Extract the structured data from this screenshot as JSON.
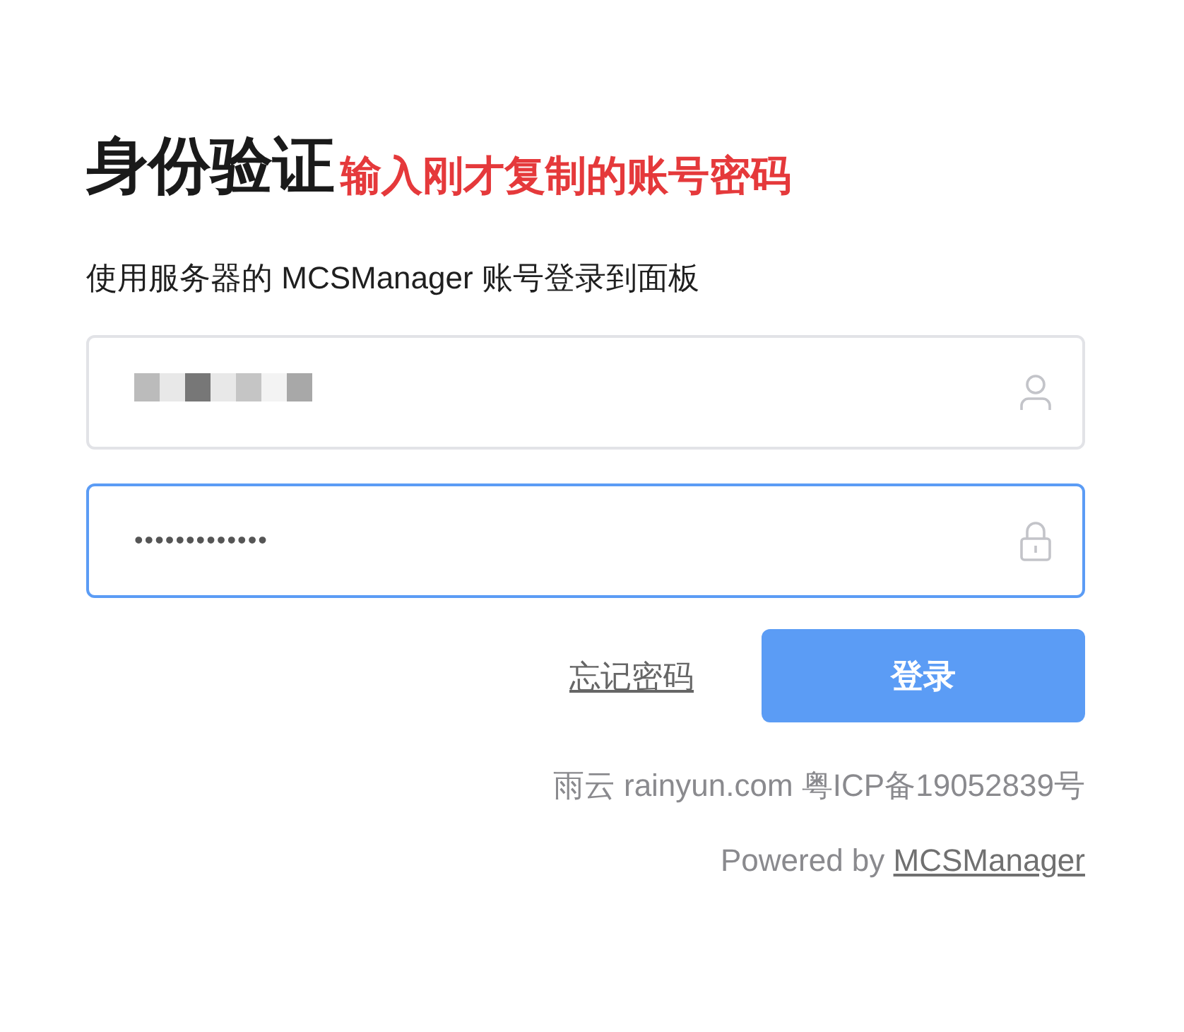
{
  "title": "身份验证",
  "annotation": "输入刚才复制的账号密码",
  "subtitle": "使用服务器的 MCSManager 账号登录到面板",
  "fields": [
    {
      "kind": "username",
      "redacted": true,
      "focused": false
    },
    {
      "kind": "password",
      "value": "•••••••••••••",
      "focused": true
    }
  ],
  "forgot_link": "忘记密码",
  "login_button": "登录",
  "footer": {
    "icp": "雨云 rainyun.com 粤ICP备19052839号",
    "powered_prefix": "Powered by",
    "powered_link": "MCSManager"
  }
}
